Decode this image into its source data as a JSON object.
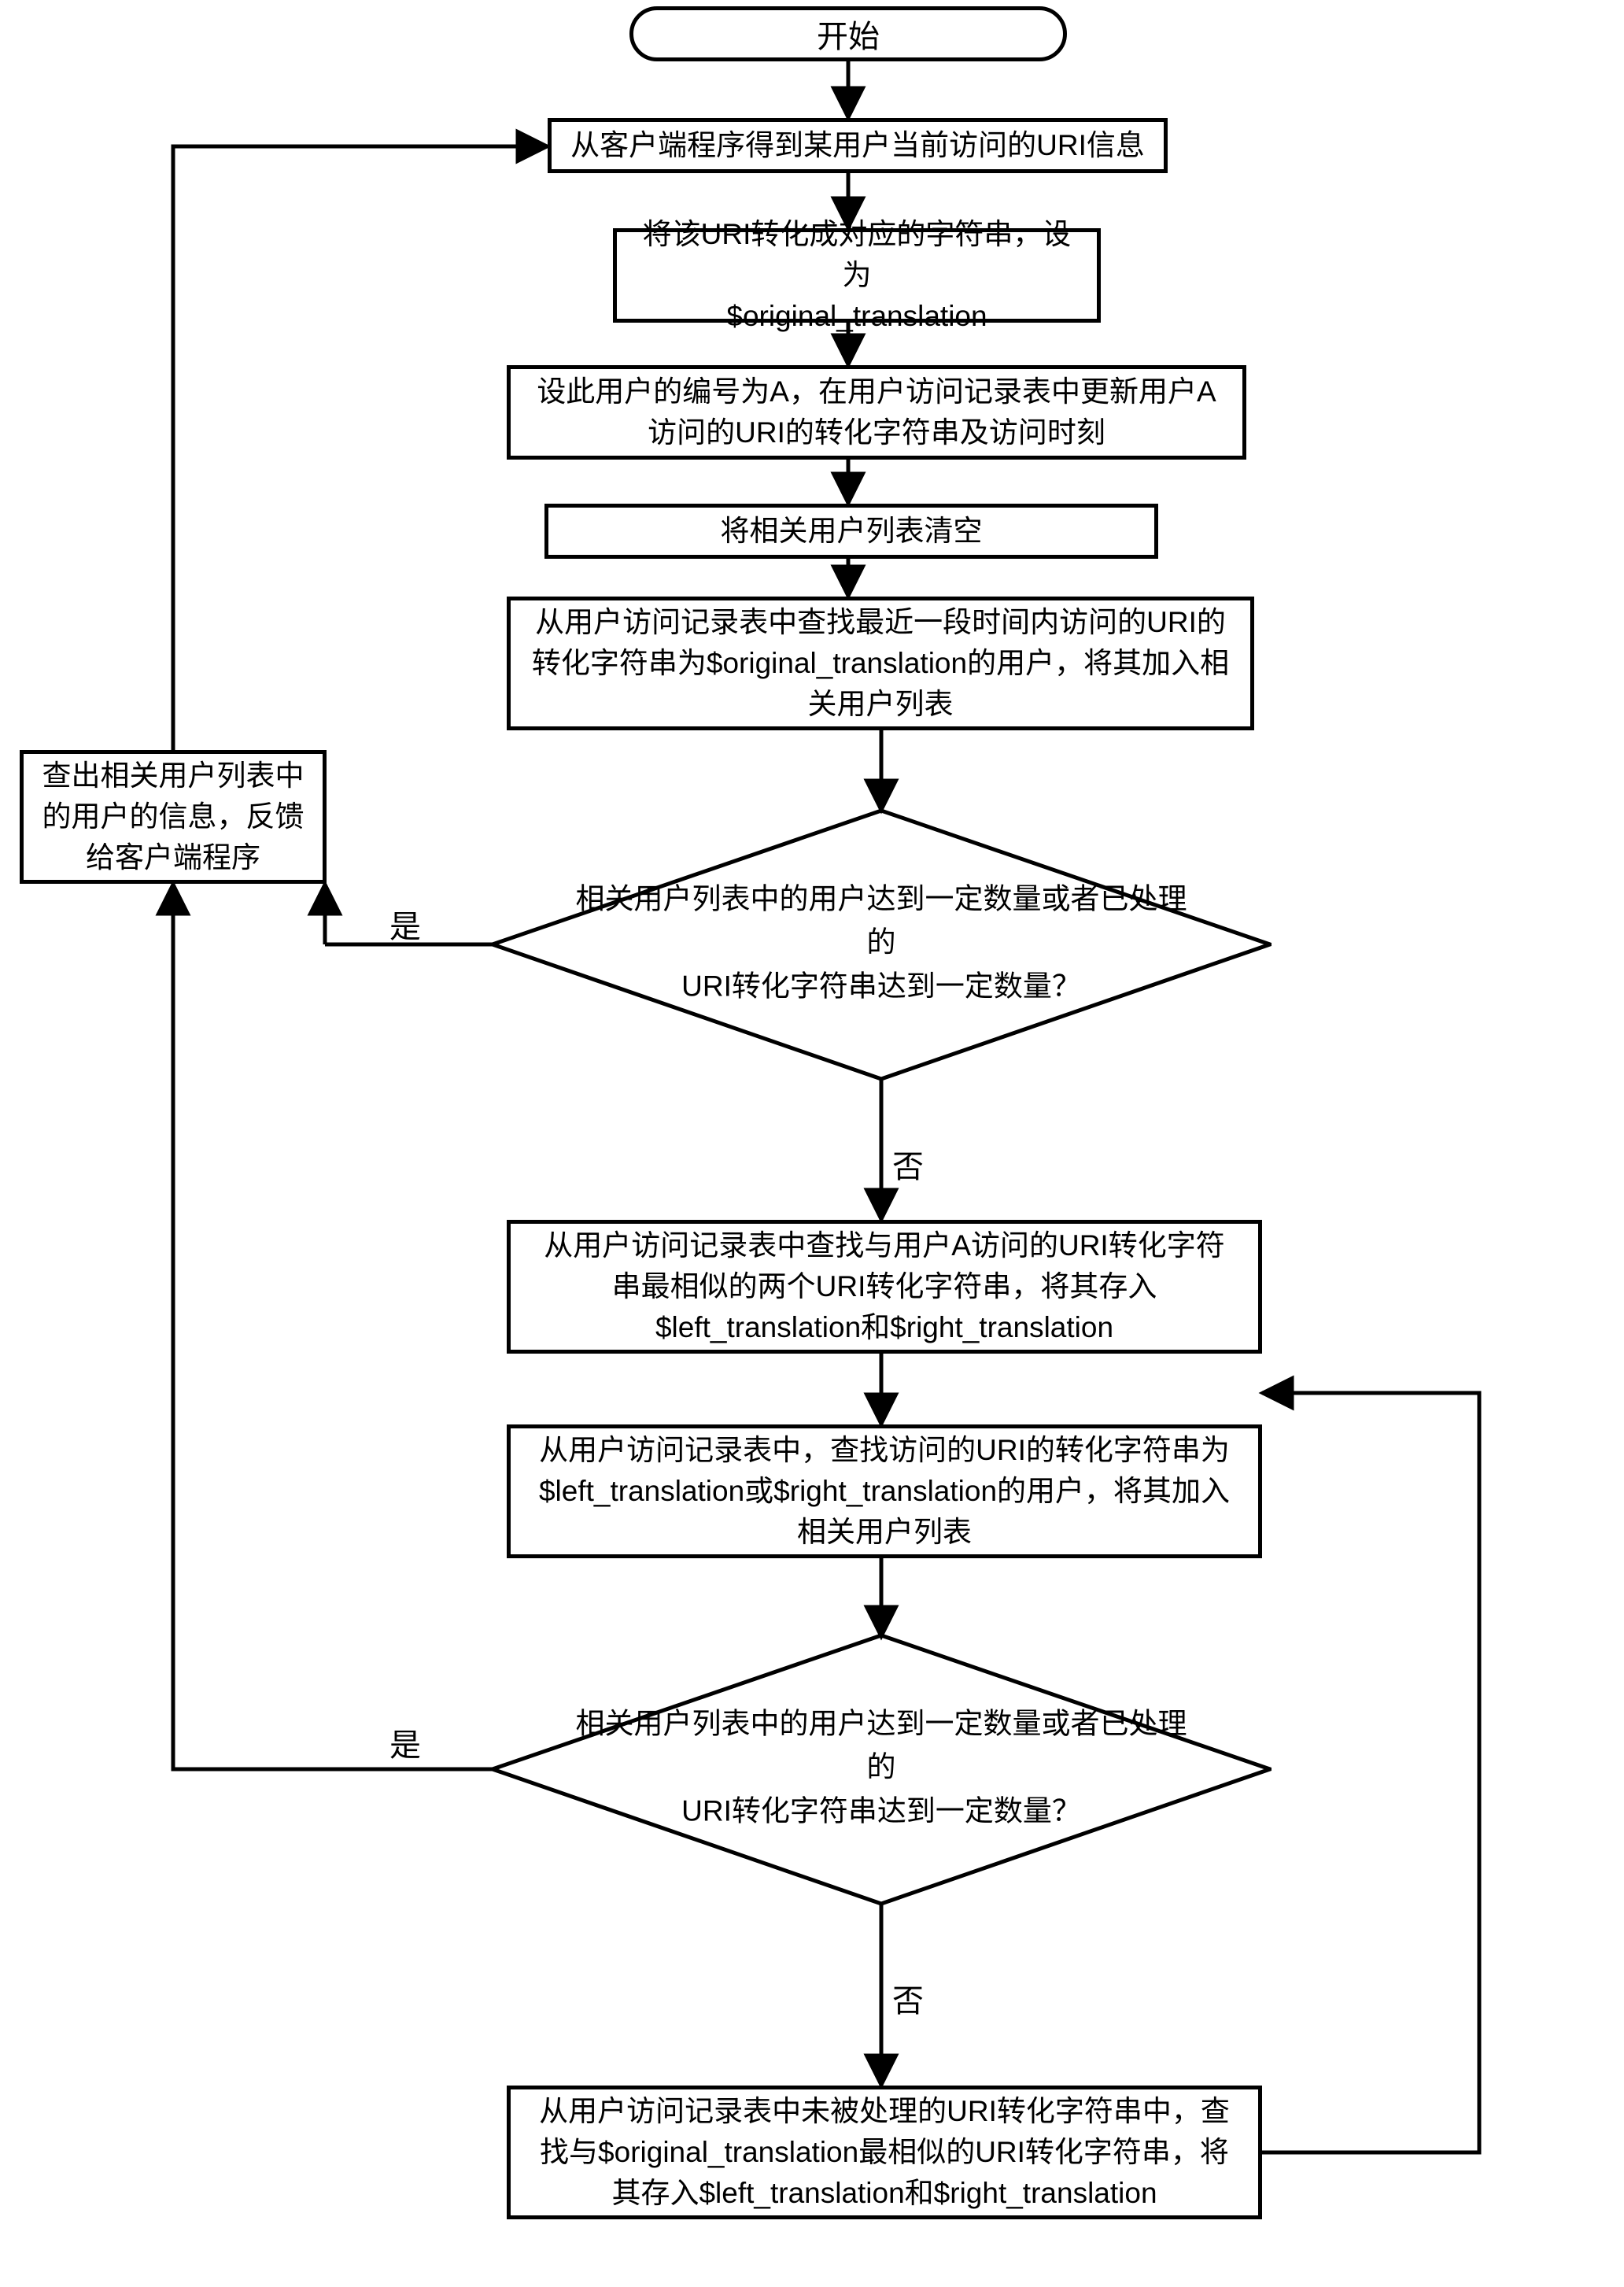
{
  "chart_data": {
    "type": "flowchart",
    "nodes": [
      {
        "id": "start",
        "shape": "terminator",
        "text": "开始"
      },
      {
        "id": "s1",
        "shape": "process",
        "text": "从客户端程序得到某用户当前访问的URI信息"
      },
      {
        "id": "s2",
        "shape": "process",
        "text": "将该URI转化成对应的字符串，设为\n$original_translation"
      },
      {
        "id": "s3",
        "shape": "process",
        "text": "设此用户的编号为A，在用户访问记录表中更新用户A\n访问的URI的转化字符串及访问时刻"
      },
      {
        "id": "s4",
        "shape": "process",
        "text": "将相关用户列表清空"
      },
      {
        "id": "s5",
        "shape": "process",
        "text": "从用户访问记录表中查找最近一段时间内访问的URI的\n转化字符串为$original_translation的用户，将其加入相\n关用户列表"
      },
      {
        "id": "out",
        "shape": "process",
        "text": "查出相关用户列表中\n的用户的信息，反馈\n给客户端程序"
      },
      {
        "id": "d1",
        "shape": "decision",
        "text": "相关用户列表中的用户达到一定数量或者已处理的\nURI转化字符串达到一定数量？"
      },
      {
        "id": "s6",
        "shape": "process",
        "text": "从用户访问记录表中查找与用户A访问的URI转化字符\n串最相似的两个URI转化字符串，将其存入\n$left_translation和$right_translation"
      },
      {
        "id": "s7",
        "shape": "process",
        "text": "从用户访问记录表中，查找访问的URI的转化字符串为\n$left_translation或$right_translation的用户，将其加入\n相关用户列表"
      },
      {
        "id": "d2",
        "shape": "decision",
        "text": "相关用户列表中的用户达到一定数量或者已处理的\nURI转化字符串达到一定数量？"
      },
      {
        "id": "s8",
        "shape": "process",
        "text": "从用户访问记录表中未被处理的URI转化字符串中，查\n找与$original_translation最相似的URI转化字符串，将\n其存入$left_translation和$right_translation"
      }
    ],
    "edges": [
      {
        "from": "start",
        "to": "s1"
      },
      {
        "from": "s1",
        "to": "s2"
      },
      {
        "from": "s2",
        "to": "s3"
      },
      {
        "from": "s3",
        "to": "s4"
      },
      {
        "from": "s4",
        "to": "s5"
      },
      {
        "from": "s5",
        "to": "d1"
      },
      {
        "from": "d1",
        "to": "out",
        "label": "是"
      },
      {
        "from": "d1",
        "to": "s6",
        "label": "否"
      },
      {
        "from": "s6",
        "to": "s7"
      },
      {
        "from": "s7",
        "to": "d2"
      },
      {
        "from": "d2",
        "to": "out",
        "label": "是"
      },
      {
        "from": "d2",
        "to": "s8",
        "label": "否"
      },
      {
        "from": "s8",
        "to": "s7",
        "note": "loop-back-right"
      },
      {
        "from": "out",
        "to": "s1",
        "note": "loop-back-top"
      }
    ],
    "labels": {
      "yes": "是",
      "no": "否"
    }
  }
}
